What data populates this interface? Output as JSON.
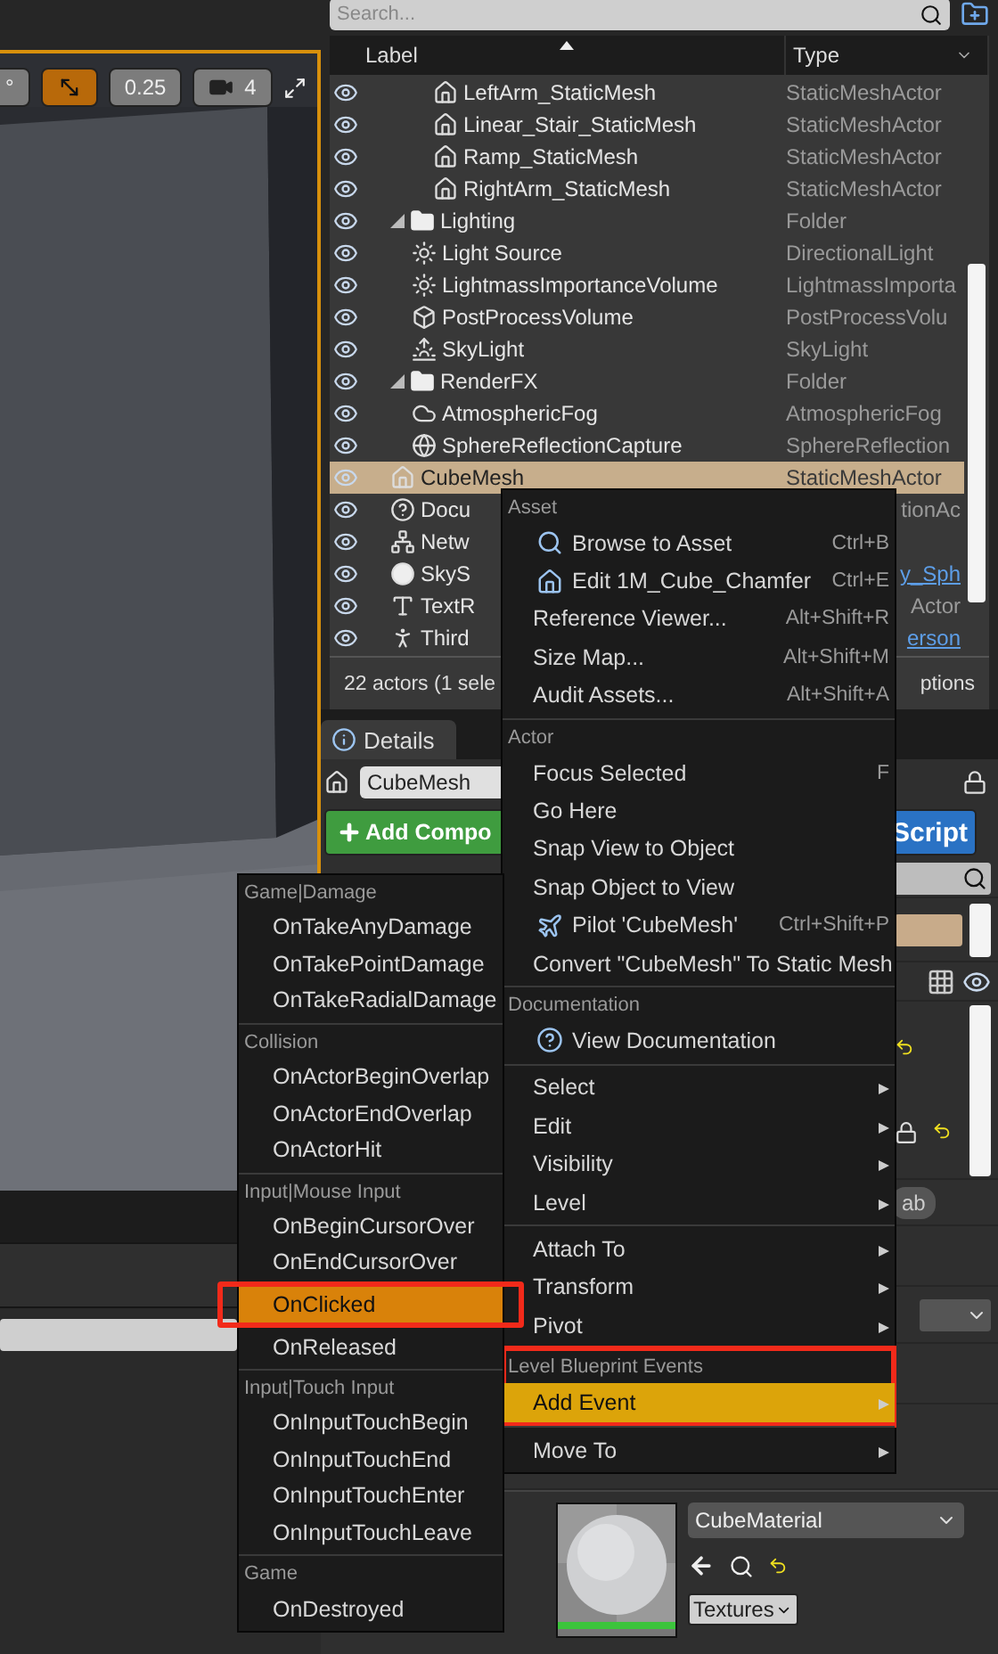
{
  "viewport": {
    "toolbar": {
      "angle_snap": "°",
      "scale_snap": {
        "on": true,
        "value": "0.25"
      },
      "camera_speed": "4"
    }
  },
  "outliner": {
    "search": {
      "placeholder": "Search..."
    },
    "columns": [
      "Label",
      "Type"
    ],
    "continued_rows": [
      {
        "label": "LeftArm_StaticMesh",
        "type": "StaticMeshActor",
        "kind": "mesh",
        "selected": false,
        "link": false
      },
      {
        "label": "Linear_Stair_StaticMesh",
        "type": "StaticMeshActor",
        "kind": "mesh",
        "selected": false,
        "link": false
      },
      {
        "label": "Ramp_StaticMesh",
        "type": "StaticMeshActor",
        "kind": "mesh",
        "selected": false,
        "link": false
      },
      {
        "label": "RightArm_StaticMesh",
        "type": "StaticMeshActor",
        "kind": "mesh",
        "selected": false,
        "link": false
      }
    ],
    "rows": [
      {
        "label": "Lighting",
        "type": "Folder",
        "kind": "folder",
        "expanded": true,
        "selected": false,
        "link": false,
        "children": [
          {
            "label": "Light Source",
            "type": "DirectionalLight",
            "kind": "light",
            "selected": false,
            "link": false
          },
          {
            "label": "LightmassImportanceVolume",
            "type": "LightmassImporta",
            "kind": "volume",
            "selected": false,
            "link": false
          },
          {
            "label": "PostProcessVolume",
            "type": "PostProcessVolu",
            "kind": "cube",
            "selected": false,
            "link": false
          },
          {
            "label": "SkyLight",
            "type": "SkyLight",
            "kind": "skylight",
            "selected": false,
            "link": false
          }
        ]
      },
      {
        "label": "RenderFX",
        "type": "Folder",
        "kind": "folder",
        "expanded": true,
        "selected": false,
        "link": false,
        "children": [
          {
            "label": "AtmosphericFog",
            "type": "AtmosphericFog",
            "kind": "fog",
            "selected": false,
            "link": false
          },
          {
            "label": "SphereReflectionCapture",
            "type": "SphereReflection",
            "kind": "globe",
            "selected": false,
            "link": false
          }
        ]
      },
      {
        "label": "CubeMesh",
        "type": "StaticMeshActor",
        "kind": "mesh",
        "selected": true,
        "link": false
      },
      {
        "label": "Docu",
        "type": "tionAc",
        "kind": "help",
        "selected": false,
        "link": false
      },
      {
        "label": "Netw",
        "kind": "network",
        "selected": false
      },
      {
        "label": "SkyS",
        "type": "y_Sph",
        "kind": "sphere",
        "selected": false,
        "link": true
      },
      {
        "label": "TextR",
        "type": "Actor",
        "kind": "text",
        "selected": false,
        "link": false
      },
      {
        "label": "Third",
        "type": "erson",
        "kind": "figure",
        "selected": false,
        "link": true
      }
    ],
    "footer": {
      "count": "22 actors (1 sele",
      "options": "ptions"
    }
  },
  "details": {
    "tab": {
      "label": "Details",
      "selected": true
    },
    "name": "CubeMesh",
    "add_button": "Add Compo",
    "script_button": "Script",
    "fragment": "ab",
    "material": {
      "name": "CubeMaterial",
      "filter": "Textures"
    }
  },
  "context_menu": {
    "sections": [
      {
        "header": "Asset",
        "annotated": false,
        "items": [
          {
            "label": "Browse to Asset",
            "kind": "icon_action",
            "shortcut": "Ctrl+B",
            "selected": false
          },
          {
            "label": "Edit 1M_Cube_Chamfer",
            "kind": "icon_action",
            "shortcut": "Ctrl+E",
            "selected": false
          },
          {
            "label": "Reference Viewer...",
            "kind": "action",
            "shortcut": "Alt+Shift+R",
            "selected": false
          },
          {
            "label": "Size Map...",
            "kind": "action",
            "shortcut": "Alt+Shift+M",
            "selected": false
          },
          {
            "label": "Audit Assets...",
            "kind": "action",
            "shortcut": "Alt+Shift+A",
            "selected": false
          }
        ]
      },
      {
        "header": "Actor",
        "annotated": false,
        "items": [
          {
            "label": "Focus Selected",
            "kind": "action",
            "shortcut": "F",
            "selected": false
          },
          {
            "label": "Go Here",
            "kind": "action",
            "selected": false
          },
          {
            "label": "Snap View to Object",
            "kind": "action",
            "selected": false
          },
          {
            "label": "Snap Object to View",
            "kind": "action",
            "selected": false
          },
          {
            "label": "Pilot 'CubeMesh'",
            "kind": "icon_action",
            "shortcut": "Ctrl+Shift+P",
            "selected": false
          },
          {
            "label": "Convert \"CubeMesh\" To Static Mesh",
            "kind": "action",
            "selected": false
          }
        ]
      },
      {
        "header": "Documentation",
        "annotated": false,
        "items": [
          {
            "label": "View Documentation",
            "kind": "icon_action",
            "selected": false
          }
        ]
      },
      {
        "annotated": false,
        "items": [
          {
            "label": "Select",
            "kind": "submenu",
            "selected": false
          },
          {
            "label": "Edit",
            "kind": "submenu",
            "selected": false
          },
          {
            "label": "Visibility",
            "kind": "submenu",
            "selected": false
          },
          {
            "label": "Level",
            "kind": "submenu",
            "selected": false
          }
        ]
      },
      {
        "annotated": false,
        "items": [
          {
            "label": "Attach To",
            "kind": "submenu",
            "selected": false
          },
          {
            "label": "Transform",
            "kind": "submenu",
            "selected": false
          },
          {
            "label": "Pivot",
            "kind": "submenu",
            "selected": false
          }
        ]
      },
      {
        "header": "Level Blueprint Events",
        "annotated": true,
        "items": [
          {
            "label": "Add Event",
            "kind": "submenu",
            "selected": true
          }
        ]
      },
      {
        "annotated": false,
        "items": [
          {
            "label": "Move To",
            "kind": "submenu",
            "selected": false
          }
        ]
      }
    ]
  },
  "event_menu": {
    "sections": [
      {
        "header": "Game|Damage",
        "items": [
          {
            "label": "OnTakeAnyDamage",
            "selected": false,
            "annotated": false
          },
          {
            "label": "OnTakePointDamage",
            "selected": false,
            "annotated": false
          },
          {
            "label": "OnTakeRadialDamage",
            "selected": false,
            "annotated": false
          }
        ]
      },
      {
        "header": "Collision",
        "items": [
          {
            "label": "OnActorBeginOverlap",
            "selected": false,
            "annotated": false
          },
          {
            "label": "OnActorEndOverlap",
            "selected": false,
            "annotated": false
          },
          {
            "label": "OnActorHit",
            "selected": false,
            "annotated": false
          }
        ]
      },
      {
        "header": "Input|Mouse Input",
        "items": [
          {
            "label": "OnBeginCursorOver",
            "selected": false,
            "annotated": false
          },
          {
            "label": "OnEndCursorOver",
            "selected": false,
            "annotated": false
          },
          {
            "label": "OnClicked",
            "selected": true,
            "annotated": true
          },
          {
            "label": "OnReleased",
            "selected": false,
            "annotated": false
          }
        ]
      },
      {
        "header": "Input|Touch Input",
        "items": [
          {
            "label": "OnInputTouchBegin",
            "selected": false,
            "annotated": false
          },
          {
            "label": "OnInputTouchEnd",
            "selected": false,
            "annotated": false
          },
          {
            "label": "OnInputTouchEnter",
            "selected": false,
            "annotated": false
          },
          {
            "label": "OnInputTouchLeave",
            "selected": false,
            "annotated": false
          }
        ]
      },
      {
        "header": "Game",
        "items": [
          {
            "label": "OnDestroyed",
            "selected": false,
            "annotated": false
          }
        ]
      }
    ]
  }
}
